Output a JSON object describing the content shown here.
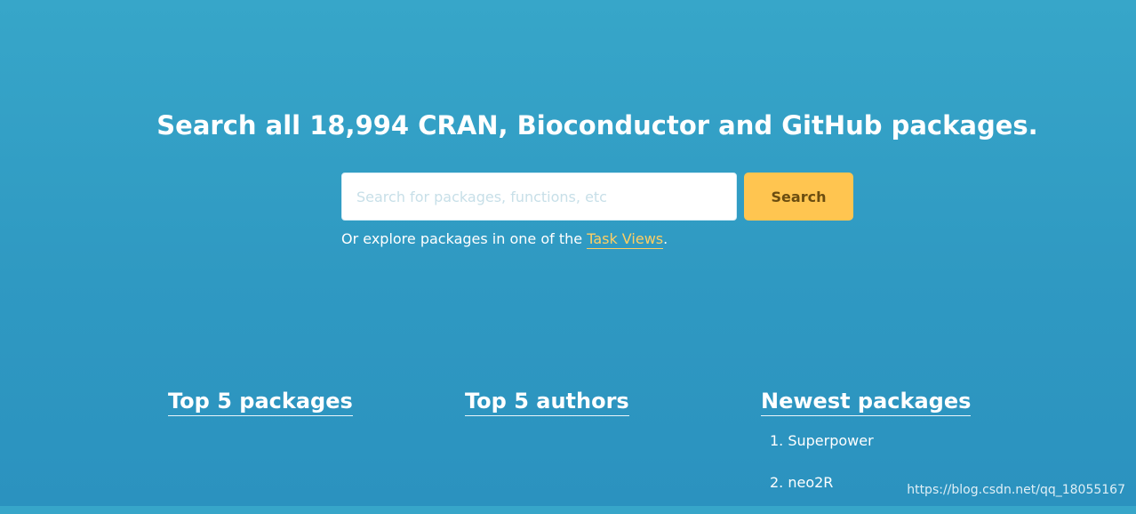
{
  "hero": {
    "title": "Search all 18,994 CRAN, Bioconductor and GitHub packages."
  },
  "search": {
    "placeholder": "Search for packages, functions, etc",
    "button_label": "Search"
  },
  "explore": {
    "prefix": "Or explore packages in one of the ",
    "link_text": "Task Views",
    "suffix": "."
  },
  "sections": {
    "top_packages_title": "Top 5 packages",
    "top_authors_title": "Top 5 authors",
    "newest_packages_title": "Newest packages"
  },
  "newest_packages": [
    "1. Superpower",
    "2. neo2R"
  ],
  "watermark": "https://blog.csdn.net/qq_18055167",
  "colors": {
    "background_top": "#37a6c9",
    "background_bottom": "#2b92bf",
    "search_button": "#ffc550",
    "link": "#ffcf63"
  }
}
